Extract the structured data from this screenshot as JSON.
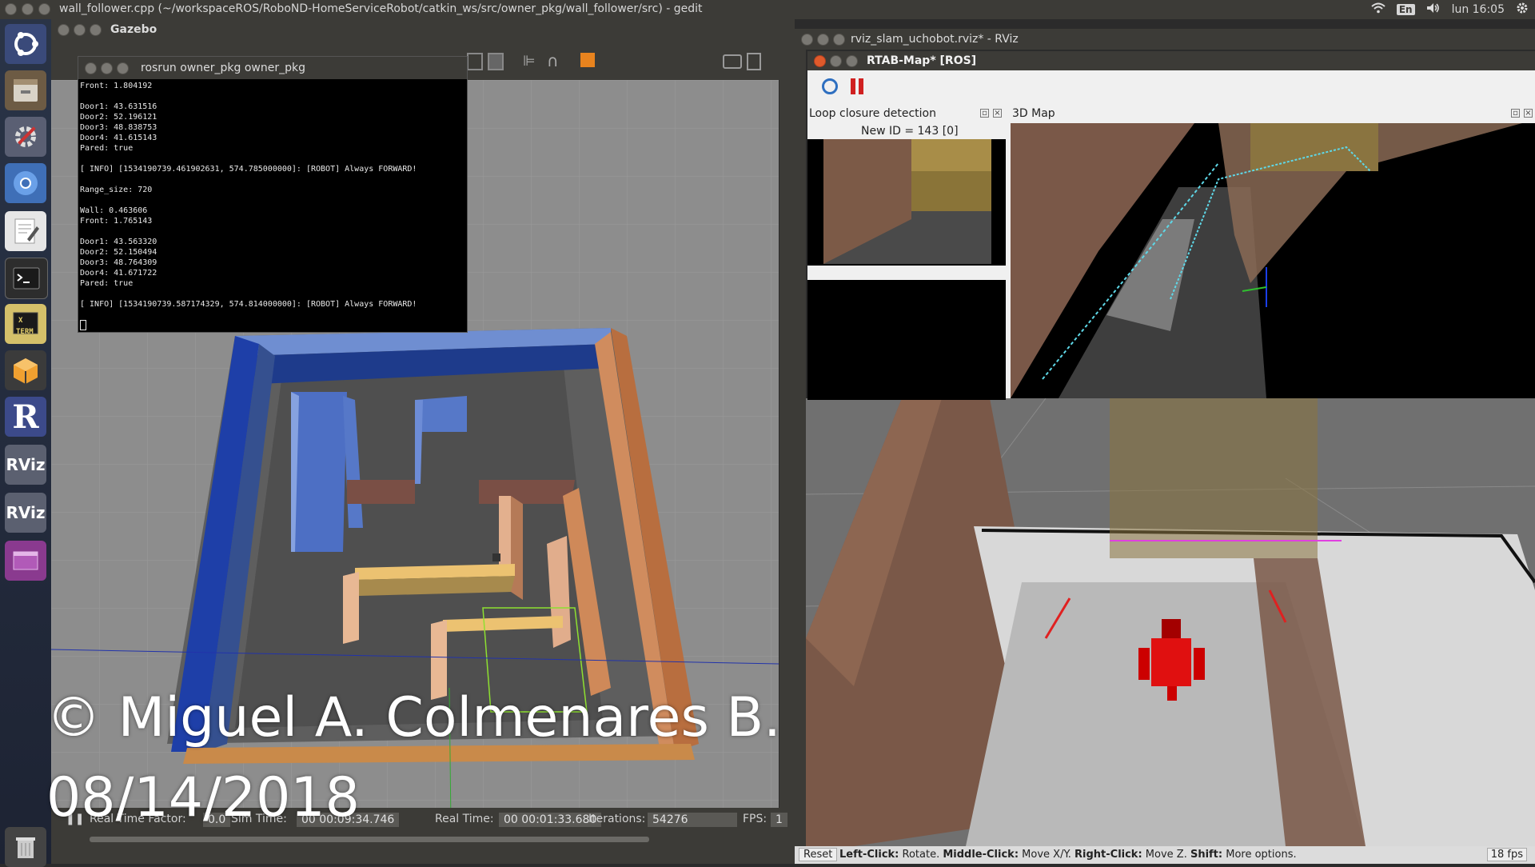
{
  "top_bar": {
    "title": "wall_follower.cpp (~/workspaceROS/RoboND-HomeServiceRobot/catkin_ws/src/owner_pkg/wall_follower/src) - gedit",
    "keyboard": "En",
    "clock": "lun 16:05"
  },
  "launcher": {
    "items": [
      "ubuntu-dash",
      "files",
      "system-settings",
      "chromium",
      "text-editor",
      "terminal",
      "xterm",
      "gazebo",
      "rqt",
      "RViz",
      "RViz",
      "workspace-switcher",
      "trash"
    ],
    "rviz_label": "RViz",
    "xterm_label": "TERM"
  },
  "gazebo": {
    "title": "Gazebo",
    "status": {
      "rtf_label": "Real Time Factor:",
      "rtf_value": "0.0",
      "sim_label": "Sim Time:",
      "sim_value": "00 00:09:34.746",
      "real_label": "Real Time:",
      "real_value": "00 00:01:33.680",
      "iter_label": "Iterations:",
      "iter_value": "54276",
      "fps_label": "FPS:",
      "fps_value": "1"
    }
  },
  "terminal": {
    "title": "rosrun owner_pkg owner_pkg",
    "lines": [
      "Front: 1.804192",
      "",
      "Door1: 43.631516",
      "Door2: 52.196121",
      "Door3: 48.838753",
      "Door4: 41.615143",
      "Pared: true",
      "",
      "[ INFO] [1534190739.461902631, 574.785000000]: [ROBOT] Always FORWARD!",
      "",
      "Range_size: 720",
      "",
      "Wall: 0.463606",
      "Front: 1.765143",
      "",
      "Door1: 43.563320",
      "Door2: 52.150494",
      "Door3: 48.764309",
      "Door4: 41.671722",
      "Pared: true",
      "",
      "[ INFO] [1534190739.587174329, 574.814000000]: [ROBOT] Always FORWARD!",
      ""
    ]
  },
  "rviz": {
    "title": "rviz_slam_uchobot.rviz* - RViz",
    "reset": "Reset",
    "hint_left": "Left-Click:",
    "hint_left_action": " Rotate. ",
    "hint_middle": "Middle-Click:",
    "hint_middle_action": " Move X/Y. ",
    "hint_right": "Right-Click:",
    "hint_right_action": " Move Z. ",
    "hint_shift": "Shift:",
    "hint_shift_action": " More options.",
    "fps": "18 fps"
  },
  "rtabmap": {
    "title": "RTAB-Map* [ROS]",
    "loop_closure_label": "Loop closure detection",
    "new_id": "New ID = 143 [0]",
    "map_label": "3D Map"
  },
  "watermark": {
    "line1": "© Miguel A. Colmenares B.",
    "line2": "08/14/2018"
  }
}
